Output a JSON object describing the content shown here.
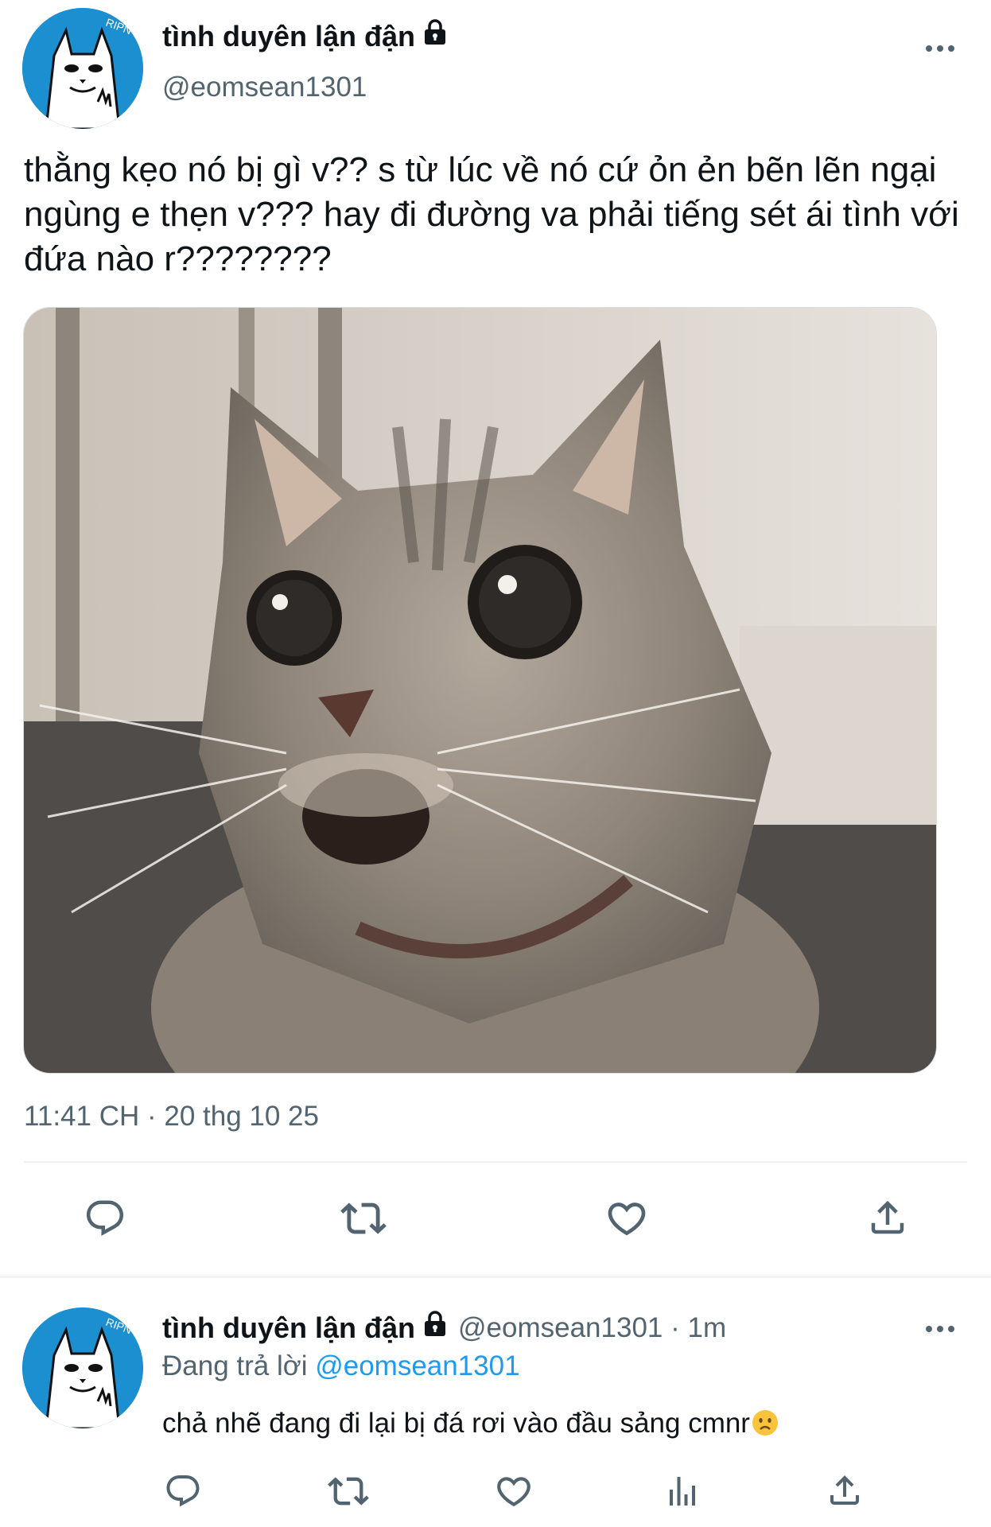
{
  "tweet": {
    "display_name": "tình duyên lận đận",
    "handle": "@eomsean1301",
    "text": "thằng kẹo nó bị gì v?? s từ lúc về nó cứ ỏn ẻn bẽn lẽn ngại ngùng e thẹn v??? hay đi đường va phải tiếng sét ái tình với đứa nào r????????",
    "timestamp": "11:41 CH · 20 thg 10 25",
    "media_icon": "surprised-cat-photo",
    "actions": [
      "reply-icon",
      "retweet-icon",
      "like-icon",
      "share-icon"
    ]
  },
  "reply": {
    "display_name": "tình duyên lận đận",
    "handle_time": "@eomsean1301 · 1m",
    "replying_prefix": "Đang trả lời ",
    "replying_mention": "@eomsean1301",
    "text": "chả nhẽ đang đi lại bị đá rơi vào đầu sảng cmnr",
    "emoji": "frowning-face-emoji",
    "actions": [
      "reply-icon",
      "retweet-icon",
      "like-icon",
      "analytics-icon",
      "share-icon"
    ]
  },
  "colors": {
    "text": "#0f1419",
    "secondary": "#536471",
    "link": "#1d9bf0",
    "divider": "#eff3f4",
    "avatar_bg": "#1b8fd0"
  }
}
